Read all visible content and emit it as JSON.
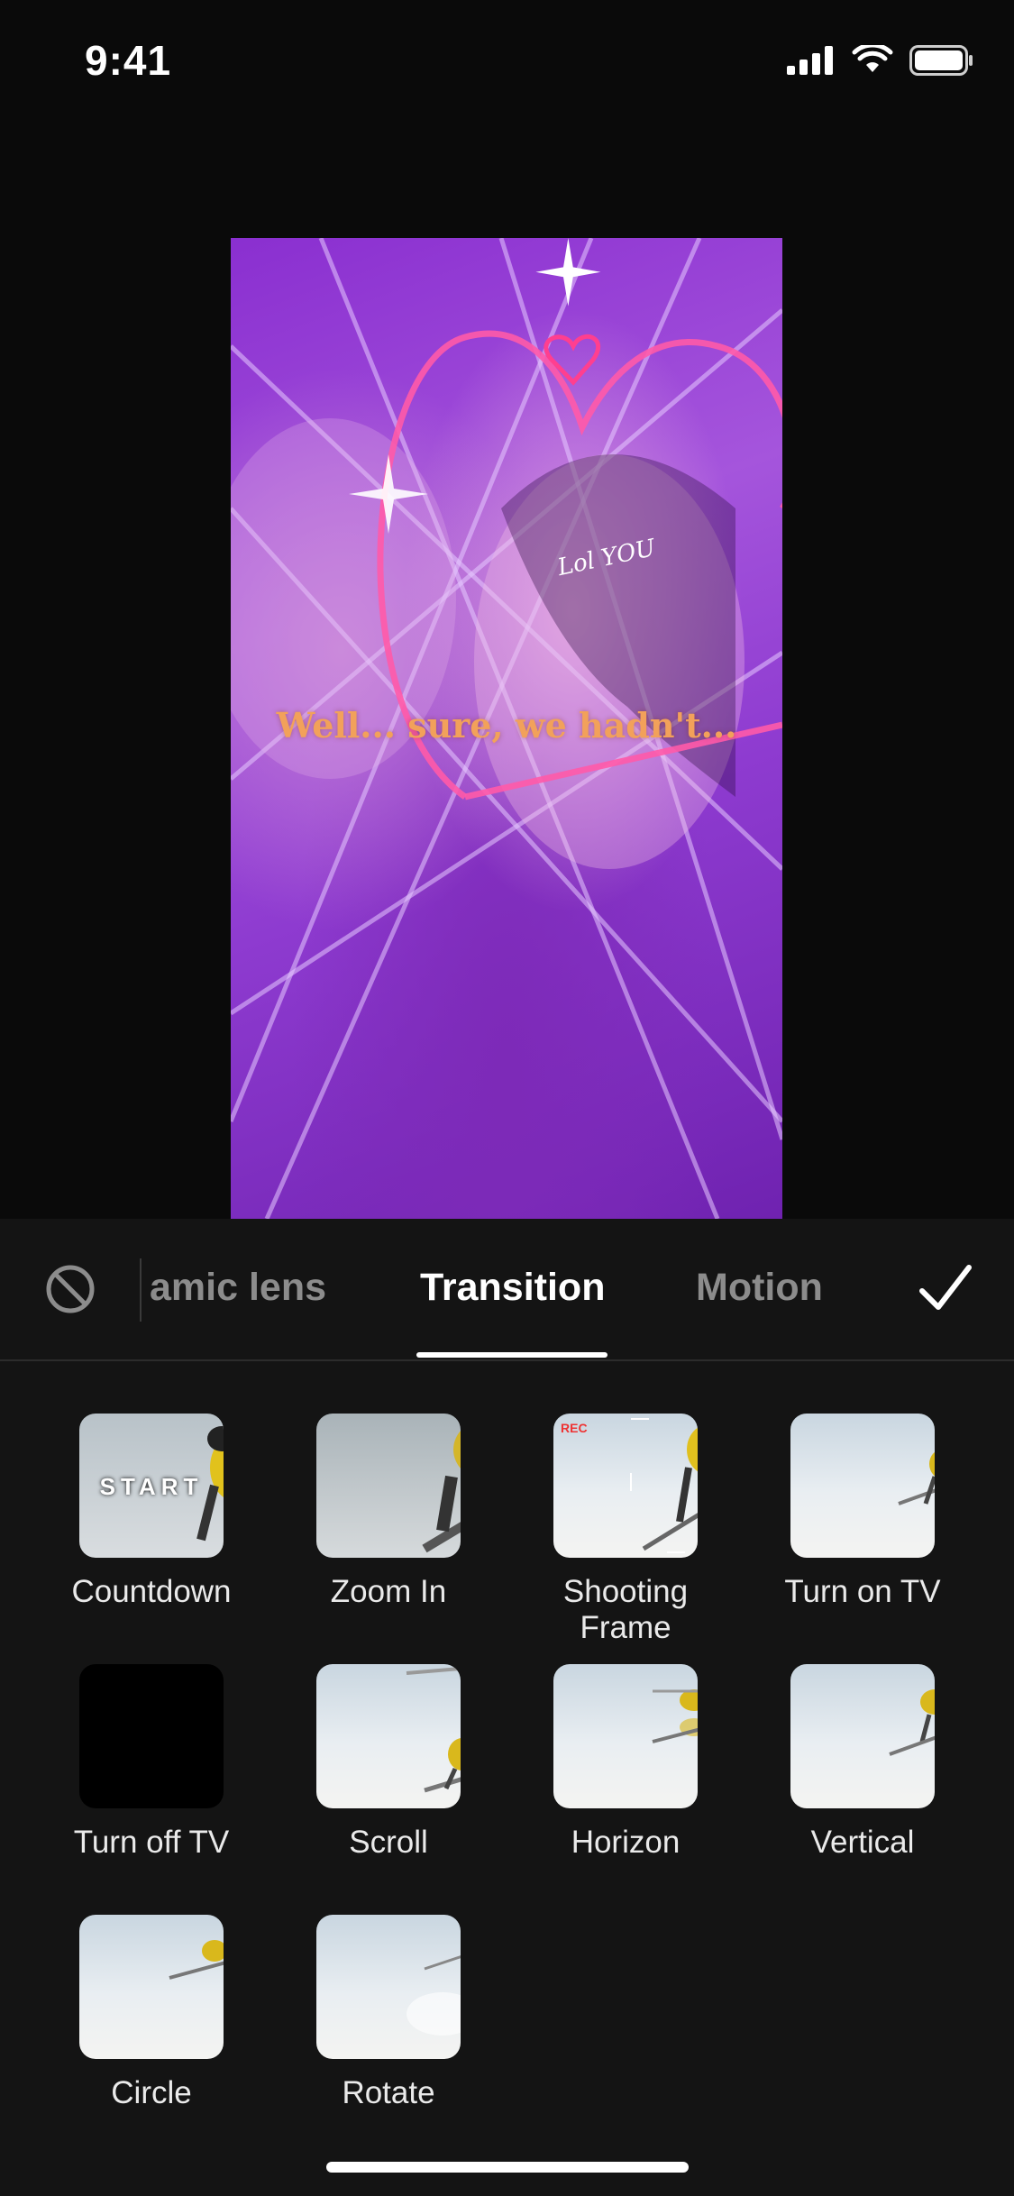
{
  "status": {
    "time": "9:41"
  },
  "preview": {
    "caption": "Well... sure, we hadn't...",
    "sticker_text": "Lol YOU"
  },
  "tabs": {
    "items": [
      {
        "label": "amic lens",
        "active": false
      },
      {
        "label": "Transition",
        "active": true
      },
      {
        "label": "Motion",
        "active": false
      }
    ]
  },
  "effects": [
    {
      "label": "Countdown",
      "overlay": "START"
    },
    {
      "label": "Zoom In"
    },
    {
      "label": "Shooting Frame",
      "overlay": "REC"
    },
    {
      "label": "Turn on TV"
    },
    {
      "label": "Turn off TV"
    },
    {
      "label": "Scroll"
    },
    {
      "label": "Horizon"
    },
    {
      "label": "Vertical"
    },
    {
      "label": "Circle"
    },
    {
      "label": "Rotate"
    }
  ],
  "colors": {
    "accent": "#ffffff",
    "caption": "#f2a15a",
    "panel": "#141414"
  }
}
